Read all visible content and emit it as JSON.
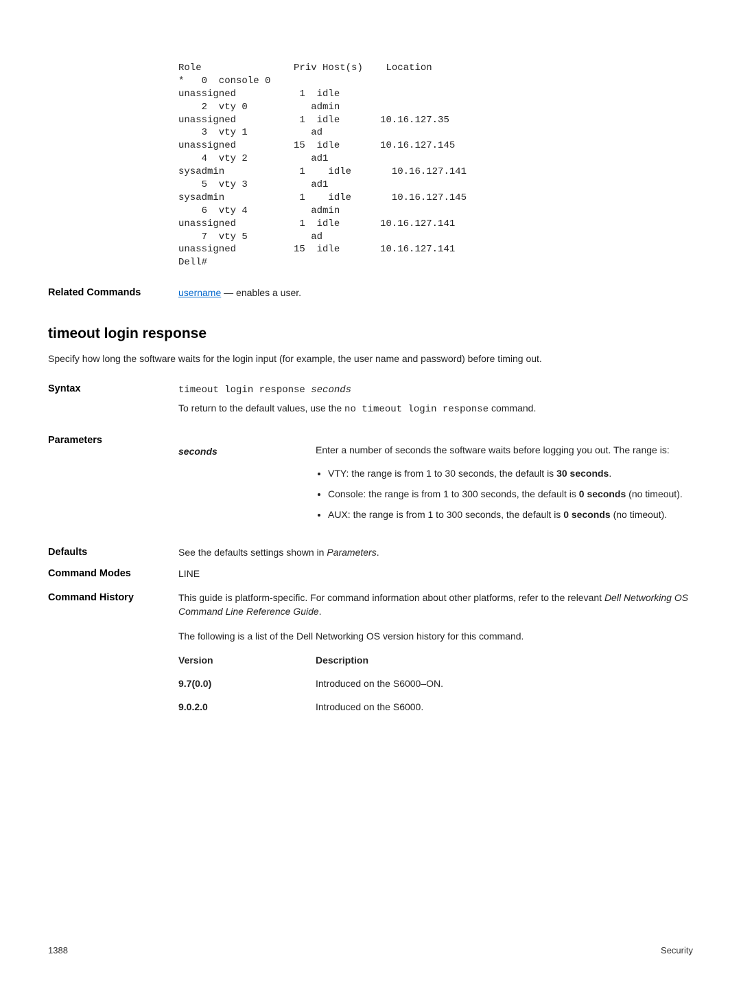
{
  "code_output": "Role                Priv Host(s)    Location\n*   0  console 0\nunassigned           1  idle\n    2  vty 0           admin\nunassigned           1  idle       10.16.127.35\n    3  vty 1           ad\nunassigned          15  idle       10.16.127.145\n    4  vty 2           ad1\nsysadmin             1    idle       10.16.127.141\n    5  vty 3           ad1\nsysadmin             1    idle       10.16.127.145\n    6  vty 4           admin\nunassigned           1  idle       10.16.127.141\n    7  vty 5           ad\nunassigned          15  idle       10.16.127.141\nDell#",
  "related": {
    "label": "Related Commands",
    "link_text": "username",
    "after_text": " — enables a user."
  },
  "section_title": "timeout login response",
  "lead_text": "Specify how long the software waits for the login input (for example, the user name and password) before timing out.",
  "syntax": {
    "label": "Syntax",
    "cmd": "timeout login response ",
    "cmd_italic": "seconds",
    "desc_before": "To return to the default values, use the ",
    "desc_code": "no timeout login response",
    "desc_after": " command."
  },
  "parameters": {
    "label": "Parameters",
    "name": "seconds",
    "desc": "Enter a number of seconds the software waits before logging you out. The range is:",
    "bullets": [
      {
        "pre": "VTY: the range is from 1 to 30 seconds, the default is ",
        "bold": "30 seconds",
        "post": "."
      },
      {
        "pre": "Console: the range is from 1 to 300 seconds, the default is ",
        "bold": "0 seconds",
        "post": " (no timeout)."
      },
      {
        "pre": "AUX: the range is from 1 to 300 seconds, the default is ",
        "bold": "0 seconds",
        "post": " (no timeout)."
      }
    ]
  },
  "defaults": {
    "label": "Defaults",
    "pre": "See the defaults settings shown in ",
    "ital": "Parameters",
    "post": "."
  },
  "modes": {
    "label": "Command Modes",
    "value": "LINE"
  },
  "history": {
    "label": "Command History",
    "p1_a": "This guide is platform-specific. For command information about other platforms, refer to the relevant ",
    "p1_i": "Dell Networking OS Command Line Reference Guide",
    "p1_b": ".",
    "p2": "The following is a list of the Dell Networking OS version history for this command.",
    "head_v": "Version",
    "head_d": "Description",
    "rows": [
      {
        "v": "9.7(0.0)",
        "d": "Introduced on the S6000–ON."
      },
      {
        "v": "9.0.2.0",
        "d": "Introduced on the S6000."
      }
    ]
  },
  "footer": {
    "page": "1388",
    "section": "Security"
  }
}
